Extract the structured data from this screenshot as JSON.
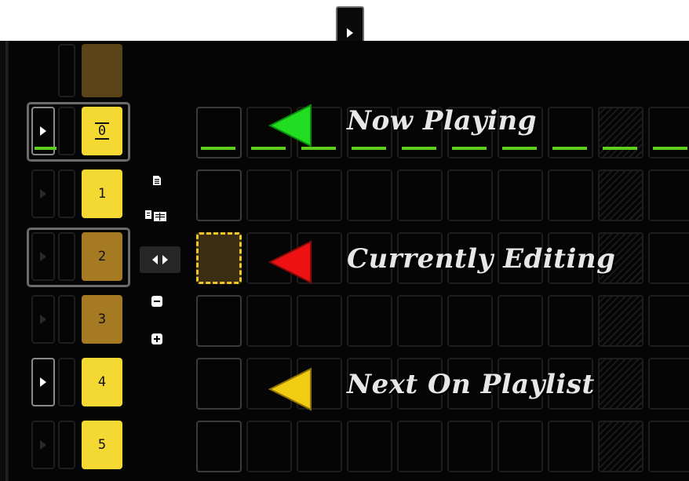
{
  "annotations": {
    "now_playing": "Now Playing",
    "currently_editing": "Currently Editing",
    "next_on_playlist": "Next On Playlist"
  },
  "scenes": [
    {
      "number": "0",
      "state": "now-playing"
    },
    {
      "number": "1",
      "state": "queued"
    },
    {
      "number": "2",
      "state": "editing"
    },
    {
      "number": "3",
      "state": "empty"
    },
    {
      "number": "4",
      "state": "next"
    },
    {
      "number": "5",
      "state": "queued"
    }
  ],
  "colors": {
    "now_playing_arrow": "#22dd22",
    "editing_arrow": "#ee1111",
    "next_arrow": "#f2cc10",
    "scene_active": "#f4d933",
    "scene_inactive": "#a67a22",
    "playhead_line": "#5ecd1e"
  },
  "tools": {
    "copy_icon": "document-icon",
    "copy_all_icon": "multi-document-icon",
    "swap_icon": "left-right-arrows-icon",
    "remove_icon": "minus-icon",
    "add_icon": "plus-icon"
  }
}
